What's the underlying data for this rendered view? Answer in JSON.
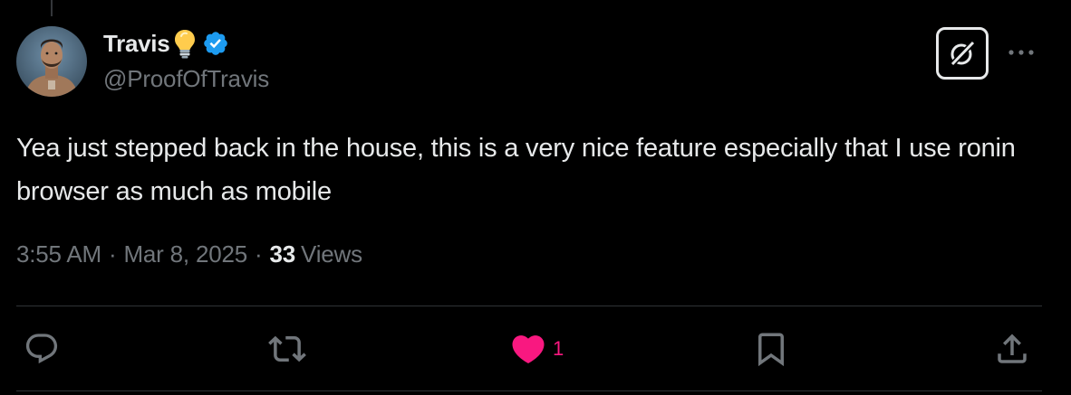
{
  "tweet": {
    "author": {
      "display_name": "Travis",
      "handle": "@ProofOfTravis",
      "verified": true,
      "name_emoji": "lightbulb-icon"
    },
    "text": "Yea just stepped back in the house, this is a very nice feature especially that I use ronin browser as much as mobile",
    "time": "3:55 AM",
    "separator": "·",
    "date": "Mar 8, 2025",
    "views_count": "33",
    "views_label": "Views"
  },
  "actions": {
    "reply": {
      "icon": "reply-icon"
    },
    "repost": {
      "icon": "repost-icon"
    },
    "like": {
      "icon": "heart-icon",
      "count": "1",
      "liked": true
    },
    "bookmark": {
      "icon": "bookmark-icon"
    },
    "share": {
      "icon": "share-icon"
    }
  },
  "colors": {
    "background": "#000000",
    "text": "#e7e9ea",
    "secondary": "#71767b",
    "verified": "#1d9bf0",
    "like": "#f91880",
    "divider": "#2f3336"
  }
}
